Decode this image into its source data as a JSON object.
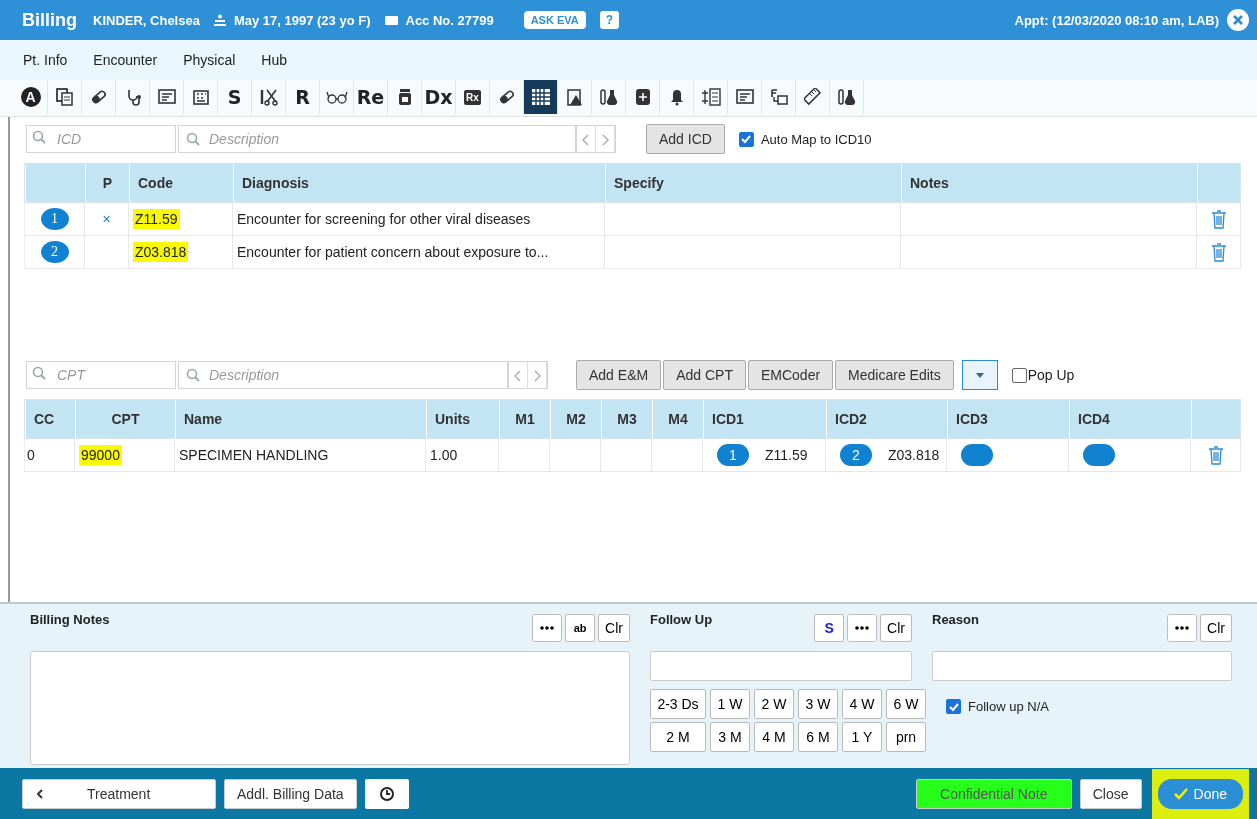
{
  "header": {
    "title": "Billing",
    "patient": "KINDER, Chelsea",
    "dob": "May 17, 1997 (23 yo F)",
    "account": "Acc No. 27799",
    "ask_button": "ASK EVA",
    "help_button": "?",
    "appointment": "Appt: (12/03/2020 08:10 am, LAB)"
  },
  "menu": [
    "Pt. Info",
    "Encounter",
    "Physical",
    "Hub"
  ],
  "toolbar": [
    {
      "kind": "circle-letter",
      "label": "A",
      "selected": false
    },
    {
      "kind": "copy",
      "selected": false
    },
    {
      "kind": "pill",
      "selected": false
    },
    {
      "kind": "stethoscope",
      "selected": false
    },
    {
      "kind": "form",
      "selected": false
    },
    {
      "kind": "building",
      "selected": false
    },
    {
      "kind": "letter",
      "label": "S",
      "selected": false
    },
    {
      "kind": "scissors",
      "selected": false
    },
    {
      "kind": "letter",
      "label": "R",
      "selected": false
    },
    {
      "kind": "glasses",
      "selected": false
    },
    {
      "kind": "letter",
      "label": "Re",
      "selected": false
    },
    {
      "kind": "jar",
      "selected": false
    },
    {
      "kind": "letter",
      "label": "Dx",
      "selected": false
    },
    {
      "kind": "boxed-letter",
      "label": "Rx",
      "selected": false
    },
    {
      "kind": "pill",
      "selected": false
    },
    {
      "kind": "calendar",
      "selected": true
    },
    {
      "kind": "clipboard",
      "selected": false
    },
    {
      "kind": "flask",
      "selected": false
    },
    {
      "kind": "cabinet",
      "selected": false
    },
    {
      "kind": "bell",
      "selected": false
    },
    {
      "kind": "list",
      "selected": false
    },
    {
      "kind": "form",
      "selected": false
    },
    {
      "kind": "flowchart",
      "selected": false
    },
    {
      "kind": "ruler",
      "selected": false
    },
    {
      "kind": "flask",
      "selected": false
    }
  ],
  "icd_search": {
    "code_placeholder": "ICD",
    "description_placeholder": "Description",
    "add_button": "Add ICD",
    "auto_map": {
      "label": "Auto Map to ICD10",
      "checked": true
    }
  },
  "icd_table": {
    "columns": [
      "P",
      "Code",
      "Diagnosis",
      "Specify",
      "Notes"
    ],
    "rows": [
      {
        "number": "1",
        "primary_mark": "×",
        "code": "Z11.59",
        "highlighted": true,
        "diagnosis": "Encounter for screening for other viral diseases"
      },
      {
        "number": "2",
        "code": "Z03.818",
        "highlighted": true,
        "diagnosis": "Encounter for patient concern about exposure to..."
      }
    ]
  },
  "cpt_search": {
    "code_placeholder": "CPT",
    "description_placeholder": "Description",
    "buttons": [
      "Add E&M",
      "Add CPT",
      "EMCoder",
      "Medicare Edits"
    ],
    "popup": {
      "label": "Pop Up",
      "checked": false
    }
  },
  "cpt_table": {
    "columns": [
      "CC",
      "CPT",
      "Name",
      "Units",
      "M1",
      "M2",
      "M3",
      "M4",
      "ICD1",
      "ICD2",
      "ICD3",
      "ICD4"
    ],
    "rows": [
      {
        "cc": "0",
        "cpt": "99000",
        "highlighted": true,
        "name": "SPECIMEN HANDLING",
        "units": "1.00",
        "icds": [
          {
            "kind": "linked",
            "number": "1",
            "code": "Z11.59"
          },
          {
            "kind": "linked",
            "number": "2",
            "code": "Z03.818"
          },
          {
            "kind": "blank"
          },
          {
            "kind": "blank"
          }
        ]
      }
    ]
  },
  "billing_notes": {
    "label": "Billing Notes",
    "spell_button": "ab",
    "clear_button": "Clr"
  },
  "follow_up": {
    "label": "Follow Up",
    "s_button": "S",
    "clear_button": "Clr",
    "durations": [
      [
        "2-3 Ds",
        "1 W",
        "2 W",
        "3 W",
        "4 W",
        "6 W"
      ],
      [
        "2 M",
        "3 M",
        "4 M",
        "6 M",
        "1 Y",
        "prn"
      ]
    ],
    "not_applicable": {
      "label": "Follow up N/A",
      "checked": true
    }
  },
  "reason": {
    "label": "Reason",
    "clear_button": "Clr"
  },
  "footer": {
    "back_button": "Treatment",
    "billing_data_button": "Addl. Billing Data",
    "confidential_button": "Confidential Note",
    "close_button": "Close",
    "done_button": "Done",
    "done_highlighted": true
  }
}
